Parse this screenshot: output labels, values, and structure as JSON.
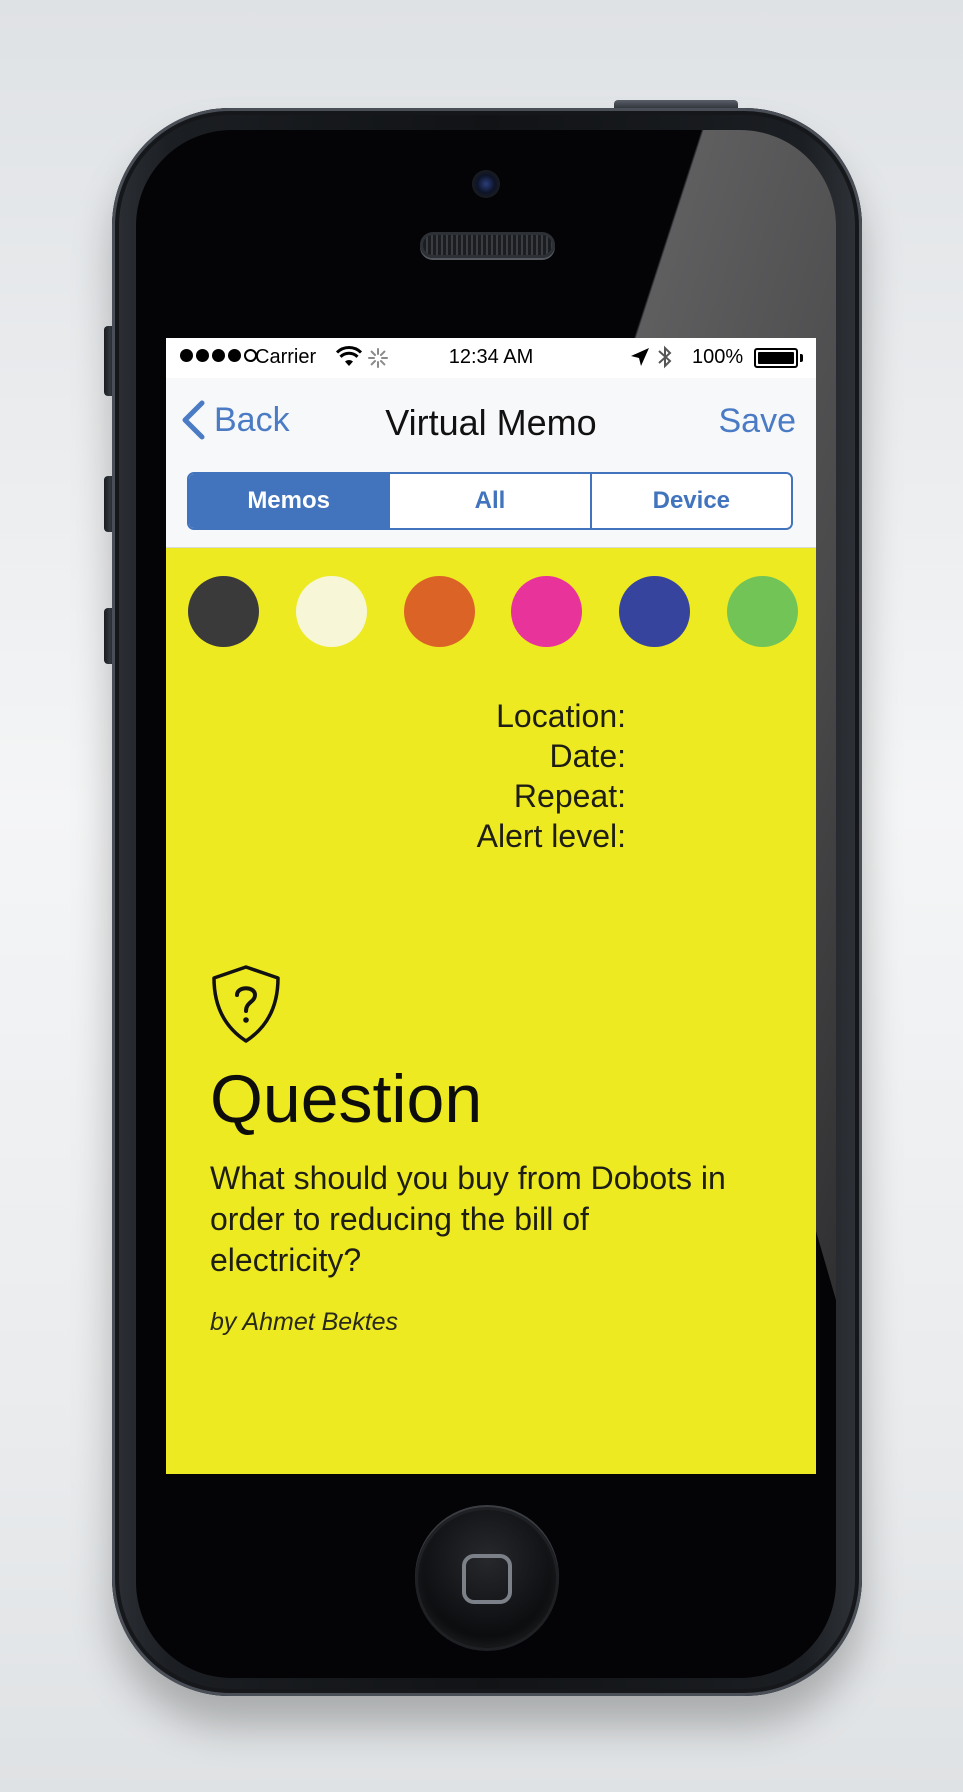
{
  "status_bar": {
    "carrier": "Carrier",
    "time": "12:34 AM",
    "battery": "100%",
    "signal_bars_filled": 4,
    "signal_bars_total": 5
  },
  "nav": {
    "back_label": "Back",
    "title": "Virtual Memo",
    "save_label": "Save"
  },
  "segments": [
    {
      "label": "Memos",
      "active": true
    },
    {
      "label": "All",
      "active": false
    },
    {
      "label": "Device",
      "active": false
    }
  ],
  "color_options": [
    "#3a3a3a",
    "#f7f7d8",
    "#dc6326",
    "#e8339a",
    "#36449e",
    "#73c457"
  ],
  "memo_fields": {
    "location": "Location:",
    "date": "Date:",
    "repeat": "Repeat:",
    "alert_level": "Alert level:"
  },
  "card": {
    "icon": "shield-question-icon",
    "title": "Question",
    "body": "What should you buy from Dobots in order to reducing the bill of electricity?",
    "author": "by Ahmet Bektes"
  },
  "colors": {
    "accent": "#4274be",
    "screen_bg": "#eeea22"
  }
}
